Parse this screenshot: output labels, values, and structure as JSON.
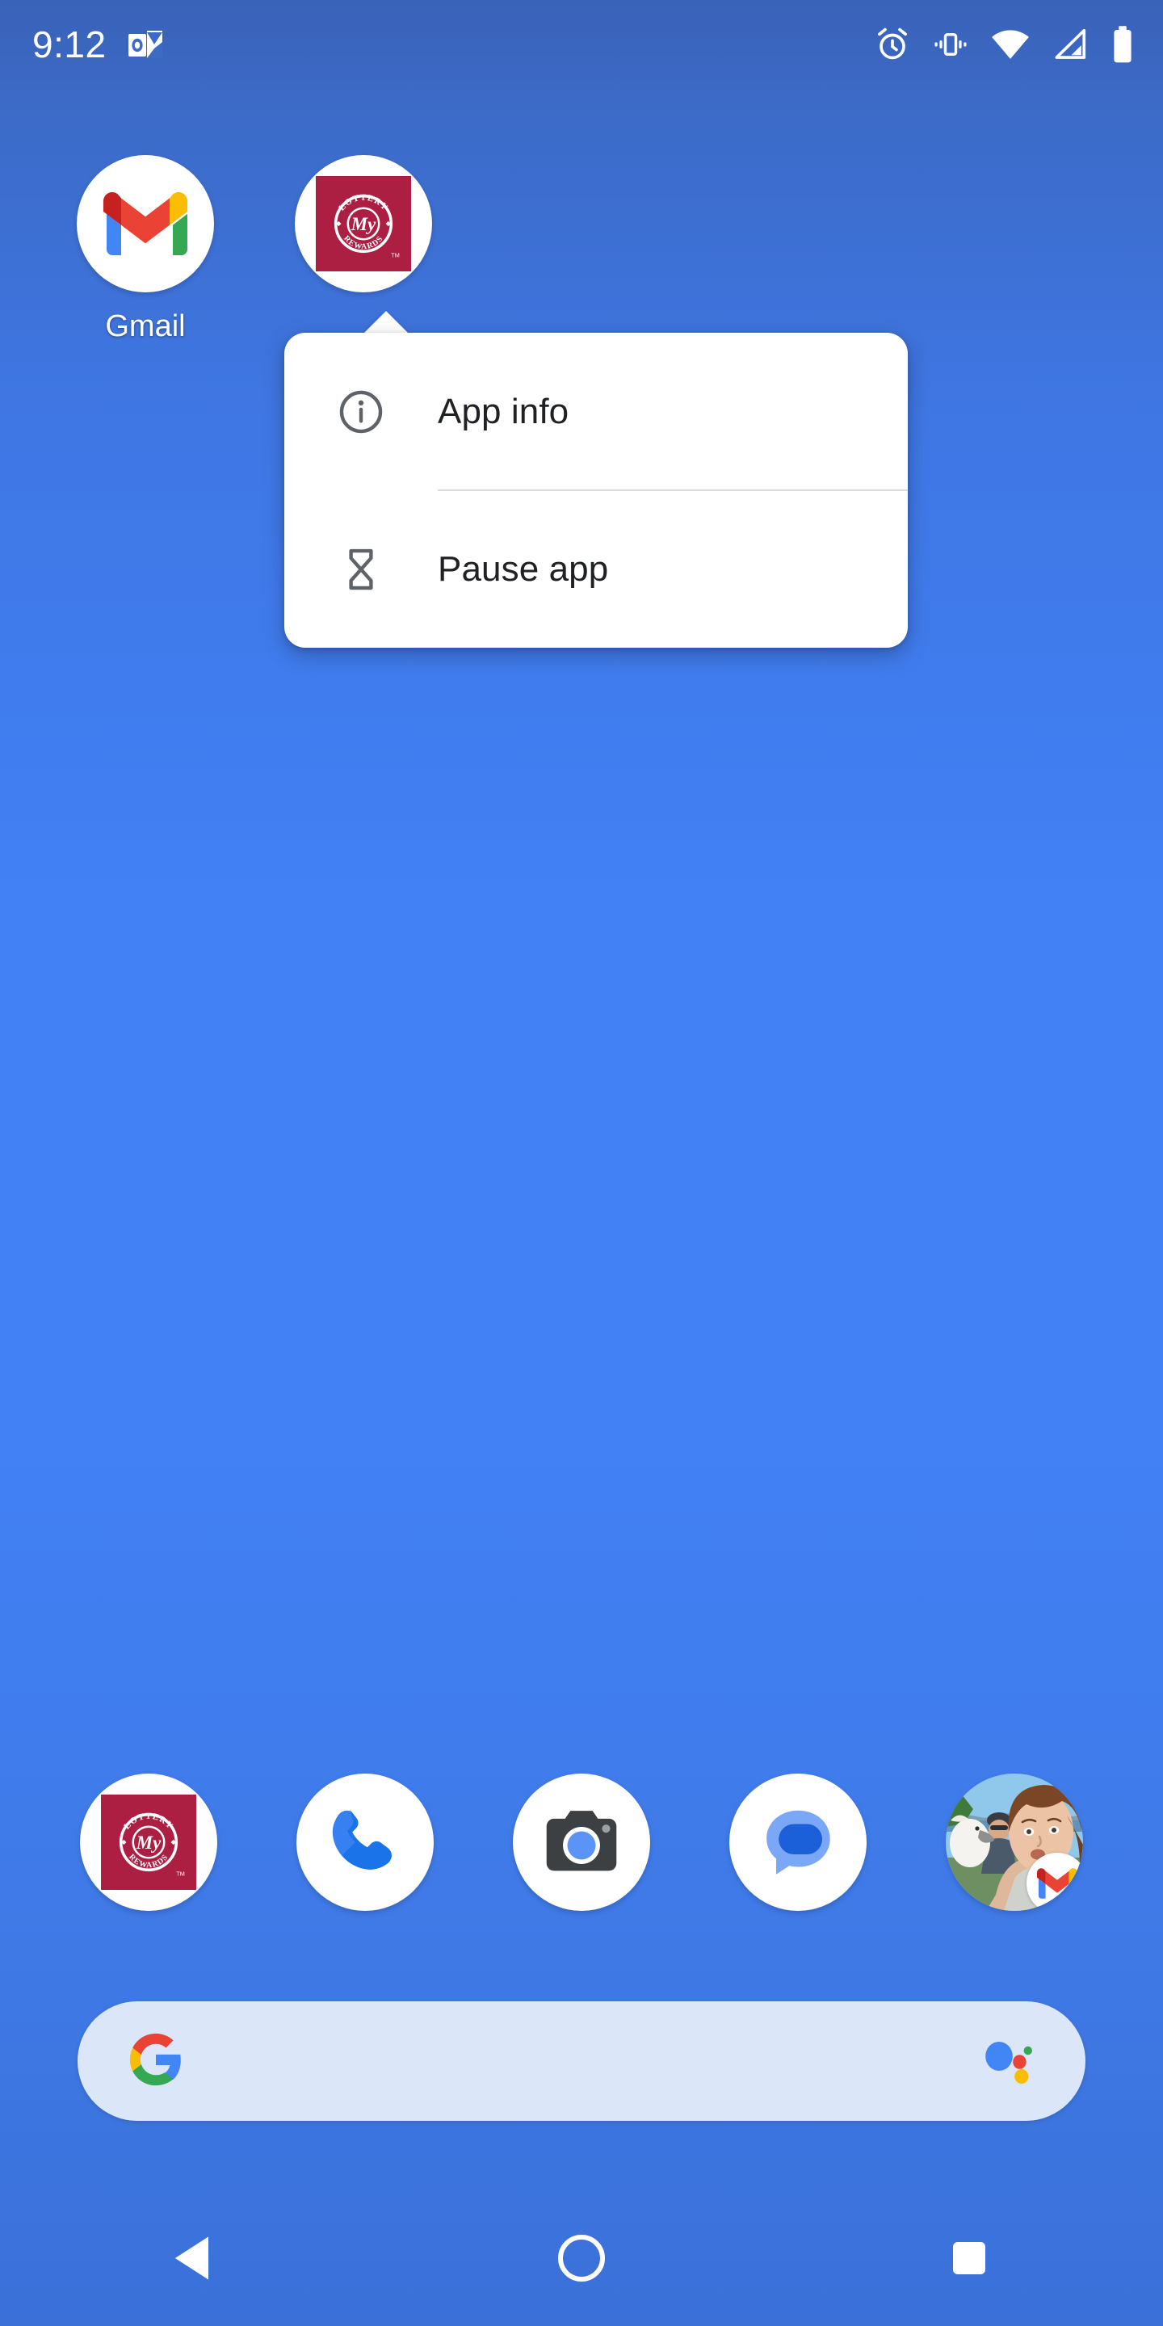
{
  "status_bar": {
    "clock": "9:12",
    "notification_icons": [
      {
        "name": "outlook-notification-icon",
        "label": "Outlook"
      }
    ],
    "system_icons": [
      {
        "name": "alarm-icon",
        "label": "Alarm set"
      },
      {
        "name": "vibrate-icon",
        "label": "Vibrate mode"
      },
      {
        "name": "wifi-icon",
        "label": "Wi-Fi connected"
      },
      {
        "name": "cellular-signal-icon",
        "label": "No cellular signal"
      },
      {
        "name": "battery-icon",
        "label": "Battery full"
      }
    ]
  },
  "home_screen": {
    "apps": [
      {
        "name": "gmail",
        "label": "Gmail",
        "icon": "gmail-icon"
      },
      {
        "name": "my-lottery-rewards",
        "label": "",
        "icon": "my-lottery-rewards-icon",
        "mark": {
          "top_text": "LOTTERY",
          "center_text": "My",
          "bottom_text": "REWARDS",
          "trademark": "TM"
        }
      }
    ]
  },
  "popup_menu": {
    "items": [
      {
        "id": "app-info",
        "label": "App info",
        "icon": "info-icon"
      },
      {
        "id": "pause-app",
        "label": "Pause app",
        "icon": "hourglass-icon"
      }
    ]
  },
  "dock": {
    "items": [
      {
        "name": "my-lottery-rewards",
        "icon": "my-lottery-rewards-icon",
        "mark": {
          "top_text": "LOTTERY",
          "center_text": "My",
          "bottom_text": "REWARDS",
          "trademark": "TM"
        }
      },
      {
        "name": "phone",
        "icon": "phone-icon"
      },
      {
        "name": "camera",
        "icon": "camera-icon"
      },
      {
        "name": "messages",
        "icon": "messages-icon"
      },
      {
        "name": "gmail-profile-shortcut",
        "icon": "avatar-photo",
        "badge_icon": "gmail-icon"
      }
    ]
  },
  "search_bar": {
    "placeholder": "",
    "leading_icon": "google-g-icon",
    "trailing_icon": "google-assistant-icon"
  },
  "nav_bar": {
    "buttons": [
      {
        "name": "back-button",
        "icon": "back-triangle-icon"
      },
      {
        "name": "home-button",
        "icon": "home-circle-icon"
      },
      {
        "name": "recents-button",
        "icon": "recents-square-icon"
      }
    ]
  },
  "colors": {
    "wallpaper_top": "#3a62b8",
    "wallpaper_mid": "#4180f5",
    "wallpaper_bottom": "#3a70d8",
    "popup_background": "#ffffff",
    "popup_text": "#202124",
    "popup_icon": "#5f6368",
    "divider": "#dadce0",
    "search_pill": "#dbe6f8",
    "lottery_crimson": "#ad1f42",
    "status_icon": "#ffffff"
  }
}
